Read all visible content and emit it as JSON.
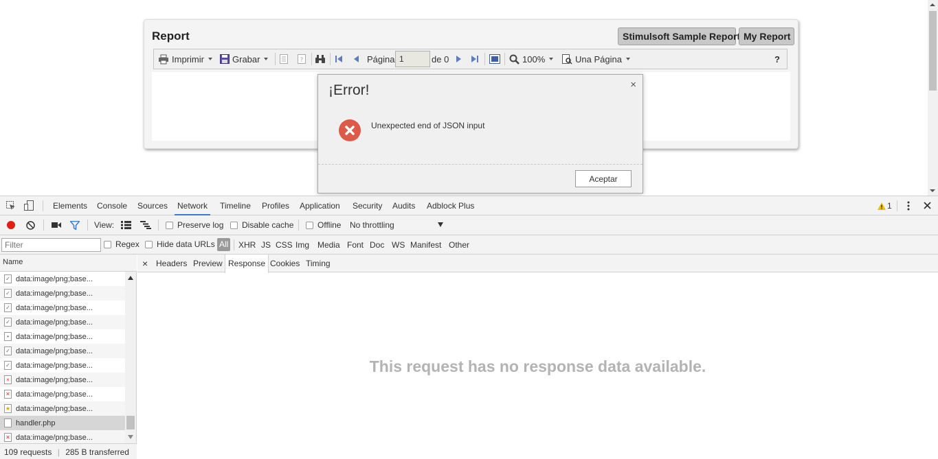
{
  "report": {
    "title": "Report",
    "tabs": [
      "Stimulsoft Sample Report",
      "My Report"
    ],
    "toolbar": {
      "print_label": "Imprimir",
      "save_label": "Grabar",
      "page_label": "Página",
      "page_value": "1",
      "page_of": "de 0",
      "zoom_label": "100%",
      "view_mode_label": "Una Página",
      "help_label": "?"
    }
  },
  "modal": {
    "title": "¡Error!",
    "close_label": "×",
    "message": "Unexpected end of JSON input",
    "ok_label": "Aceptar"
  },
  "devtools": {
    "tabs": [
      "Elements",
      "Console",
      "Sources",
      "Network",
      "Timeline",
      "Profiles",
      "Application",
      "Security",
      "Audits",
      "Adblock Plus"
    ],
    "active_tab": "Network",
    "warning_count": "1",
    "toolbar": {
      "view_label": "View:",
      "preserve_log": "Preserve log",
      "disable_cache": "Disable cache",
      "offline": "Offline",
      "throttling": "No throttling"
    },
    "filter": {
      "placeholder": "Filter",
      "regex": "Regex",
      "hide_data_urls": "Hide data URLs",
      "types": [
        "All",
        "XHR",
        "JS",
        "CSS",
        "Img",
        "Media",
        "Font",
        "Doc",
        "WS",
        "Manifest",
        "Other"
      ]
    },
    "requests": {
      "header": "Name",
      "rows": [
        {
          "name": "data:image/png;base...",
          "icon": "check-icon"
        },
        {
          "name": "data:image/png;base...",
          "icon": "check-icon"
        },
        {
          "name": "data:image/png;base...",
          "icon": "check-icon"
        },
        {
          "name": "data:image/png;base...",
          "icon": "check-icon"
        },
        {
          "name": "data:image/png;base...",
          "icon": "dot-icon"
        },
        {
          "name": "data:image/png;base...",
          "icon": "check-icon"
        },
        {
          "name": "data:image/png;base...",
          "icon": "check-icon"
        },
        {
          "name": "data:image/png;base...",
          "icon": "x-icon"
        },
        {
          "name": "data:image/png;base...",
          "icon": "error-icon"
        },
        {
          "name": "data:image/png;base...",
          "icon": "star-icon"
        },
        {
          "name": "handler.php",
          "icon": "file-icon"
        },
        {
          "name": "data:image/png;base...",
          "icon": "error-icon"
        }
      ],
      "status_requests": "109 requests",
      "status_transferred": "285 B transferred"
    },
    "detail": {
      "close_label": "×",
      "tabs": [
        "Headers",
        "Preview",
        "Response",
        "Cookies",
        "Timing"
      ],
      "active_tab": "Response",
      "empty_message": "This request has no response data available."
    }
  }
}
